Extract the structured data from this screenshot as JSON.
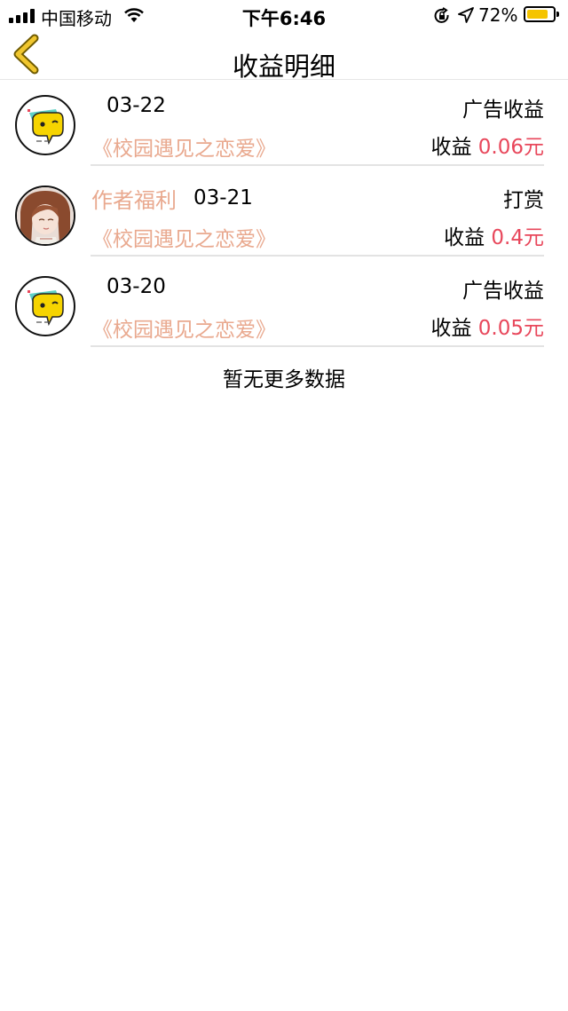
{
  "status_bar": {
    "carrier": "中国移动",
    "time": "下午6:46",
    "battery": "72%",
    "icons": [
      "signal-icon",
      "wifi-icon",
      "orientation-lock-icon",
      "location-icon",
      "battery-icon"
    ]
  },
  "nav": {
    "title": "收益明细",
    "back_icon": "chevron-left-icon",
    "accent_color": "#e5b800"
  },
  "earnings": [
    {
      "tag": "",
      "date": "03-22",
      "type": "广告收益",
      "book": "《校园遇见之恋爱》",
      "earn_label": "收益",
      "amount": "0.06元",
      "avatar": "chat-bubble-icon"
    },
    {
      "tag": "作者福利",
      "date": "03-21",
      "type": "打赏",
      "book": "《校园遇见之恋爱》",
      "earn_label": "收益",
      "amount": "0.4元",
      "avatar": "anime-girl-avatar"
    },
    {
      "tag": "",
      "date": "03-20",
      "type": "广告收益",
      "book": "《校园遇见之恋爱》",
      "earn_label": "收益",
      "amount": "0.05元",
      "avatar": "chat-bubble-icon"
    }
  ],
  "footer": {
    "no_more": "暂无更多数据"
  },
  "colors": {
    "book_title": "#e9a98f",
    "amount": "#e8475b",
    "battery_fill": "#f5c400"
  }
}
